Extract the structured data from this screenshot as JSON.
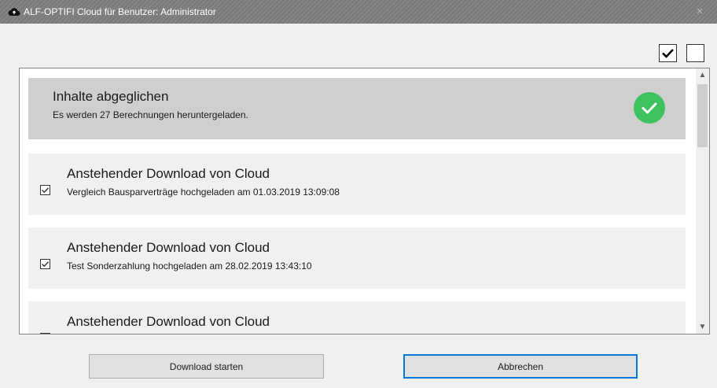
{
  "window": {
    "title": "ALF-OPTIFI Cloud für Benutzer: Administrator",
    "close_glyph": "×",
    "icon": "cloud-icon"
  },
  "toolbar": {
    "select_all_icon": "checkbox-checked-icon",
    "select_none_icon": "checkbox-empty-icon"
  },
  "status": {
    "title": "Inhalte abgeglichen",
    "subtitle": "Es werden 27 Berechnungen heruntergeladen.",
    "icon": "checkmark-icon",
    "color": "#3dc25f"
  },
  "items": [
    {
      "title": "Anstehender Download von Cloud",
      "subtitle": "Vergleich Bausparverträge hochgeladen am 01.03.2019 13:09:08",
      "checked": true
    },
    {
      "title": "Anstehender Download von Cloud",
      "subtitle": "Test Sonderzahlung hochgeladen am 28.02.2019 13:43:10",
      "checked": true
    },
    {
      "title": "Anstehender Download von Cloud",
      "subtitle": "",
      "checked": true
    }
  ],
  "buttons": {
    "download": "Download starten",
    "cancel": "Abbrechen"
  },
  "colors": {
    "titlebar": "#7d7d7d",
    "accent": "#0078d7",
    "success": "#3dc25f"
  }
}
